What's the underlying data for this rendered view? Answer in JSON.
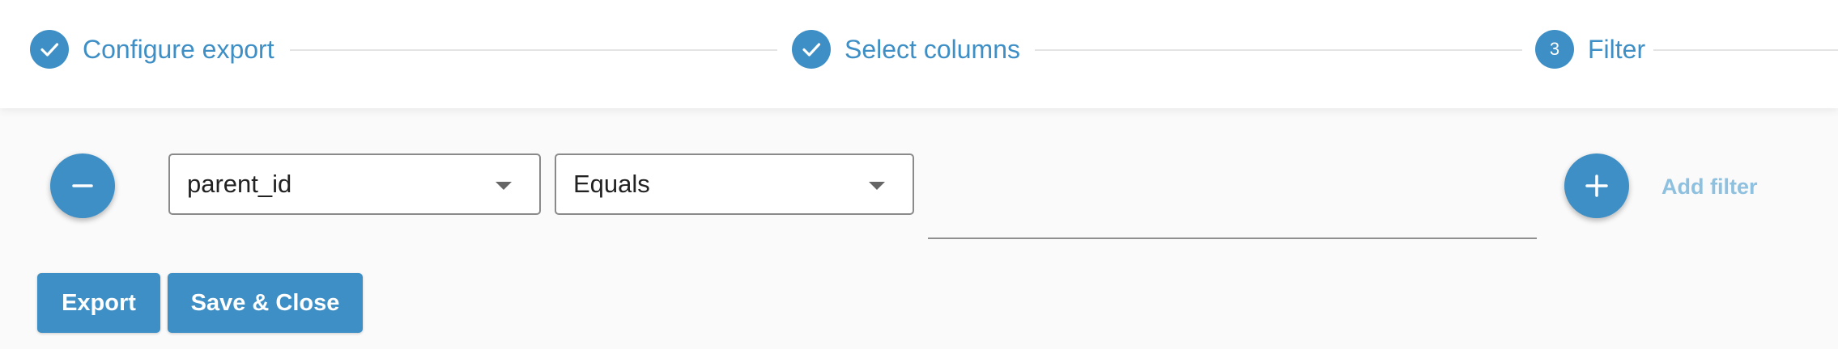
{
  "stepper": {
    "steps": [
      {
        "label": "Configure export",
        "state": "complete",
        "icon": "check-icon"
      },
      {
        "label": "Select columns",
        "state": "complete",
        "icon": "check-icon"
      },
      {
        "label": "Filter",
        "state": "active",
        "number": "3"
      }
    ]
  },
  "filter": {
    "remove_icon": "minus-icon",
    "column_select": {
      "value": "parent_id",
      "icon": "caret-down-icon"
    },
    "operator_select": {
      "value": "Equals",
      "icon": "caret-down-icon"
    },
    "value_input": {
      "value": "",
      "placeholder": ""
    },
    "add_icon": "plus-icon",
    "add_filter_label": "Add filter"
  },
  "actions": {
    "export_label": "Export",
    "save_close_label": "Save & Close"
  },
  "colors": {
    "accent": "#3e8fc5",
    "accent_light": "#8ec0df",
    "line": "#e4e4e4"
  }
}
